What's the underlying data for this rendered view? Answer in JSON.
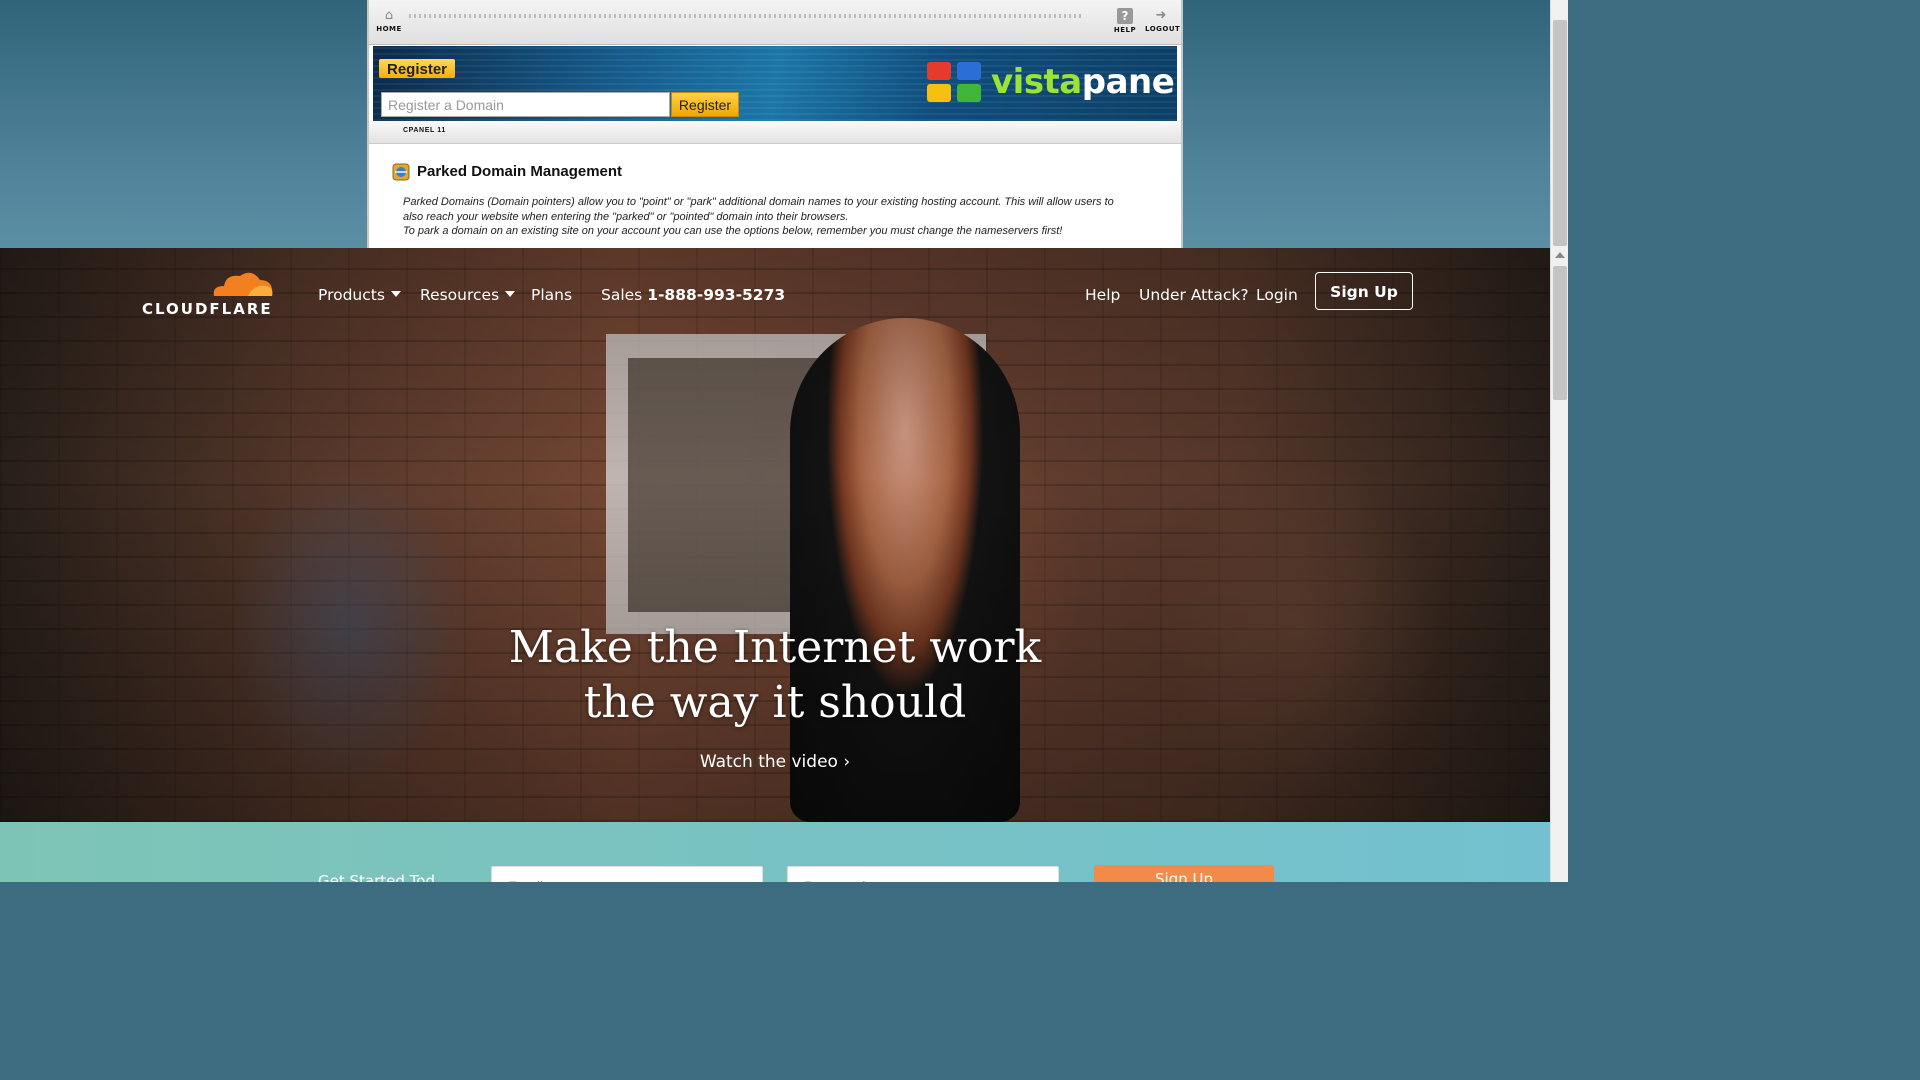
{
  "vistapanel": {
    "home_label": "HOME",
    "help_label": "HELP",
    "logout_label": "LOGOUT",
    "register_label": "Register",
    "domain_input_placeholder": "Register a Domain",
    "register_button": "Register",
    "brand_part1": "vista",
    "brand_part2": "panel",
    "cpanel_label": "CPANEL 11",
    "section_title": "Parked Domain Management",
    "desc_line1": "Parked Domains (Domain pointers) allow you to \"point\" or \"park\" additional domain names to your existing hosting account. This will allow users to",
    "desc_line2": "also reach your website when entering the \"parked\" or \"pointed\" domain into their browsers.",
    "desc_line3": "To park a domain on an existing site on your account you can use the options below, remember you must change the nameservers first!"
  },
  "cloudflare": {
    "logo_text": "CLOUDFLARE",
    "nav": {
      "products": "Products",
      "resources": "Resources",
      "plans": "Plans",
      "sales_label": "Sales",
      "sales_number": "1-888-993-5273",
      "help": "Help",
      "under_attack": "Under Attack?",
      "login": "Login",
      "sign_up": "Sign Up"
    },
    "headline_line1": "Make the Internet work",
    "headline_line2": "the way it should",
    "watch_video": "Watch the video ›",
    "get_started": {
      "label": "Get Started Tod",
      "email_placeholder": "Email",
      "password_placeholder": "Password",
      "button": "Sign Up"
    },
    "colors": {
      "brand_orange": "#f38020",
      "signup_orange": "#f28a4a"
    }
  }
}
